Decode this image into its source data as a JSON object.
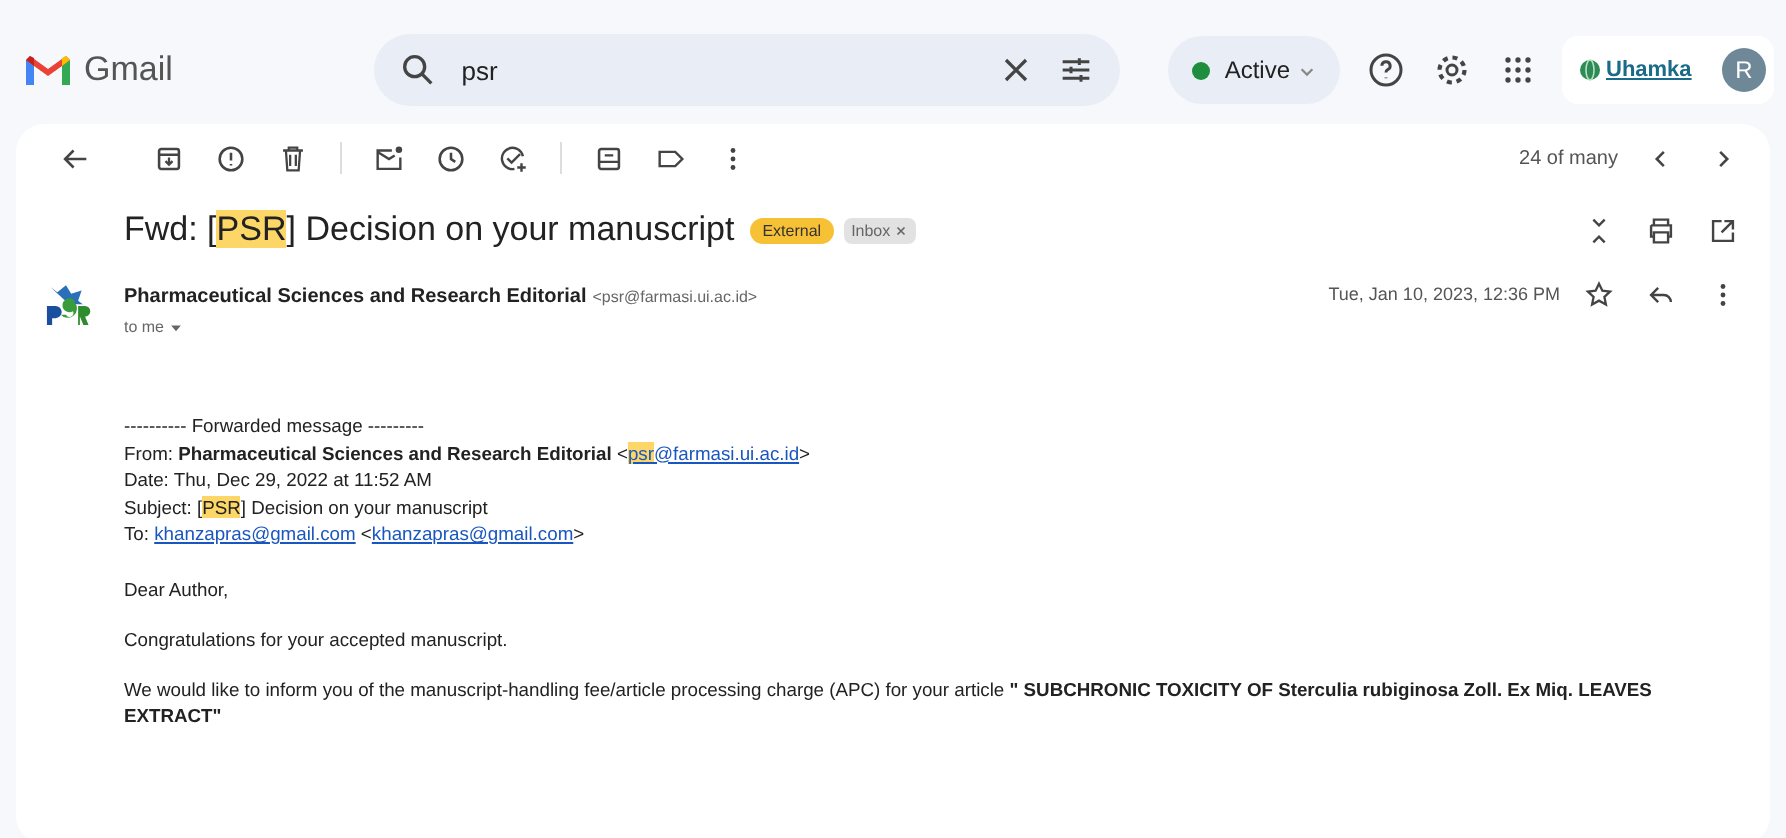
{
  "app": {
    "name": "Gmail"
  },
  "search": {
    "value": "psr"
  },
  "status": {
    "label": "Active",
    "online": true
  },
  "account": {
    "org_logo": "Uhamka",
    "avatar_letter": "R"
  },
  "toolbar": {
    "counter": "24 of many"
  },
  "message": {
    "subject_parts": [
      {
        "text": "Fwd: [",
        "highlighted": false
      },
      {
        "text": "PSR",
        "highlighted": true
      },
      {
        "text": "] Decision on your manuscript",
        "highlighted": false
      }
    ],
    "labels": [
      {
        "text": "External",
        "kind": "external"
      },
      {
        "text": "Inbox",
        "kind": "removable"
      }
    ],
    "sender_name": "Pharmaceutical Sciences and Research Editorial",
    "sender_email": "<psr@farmasi.ui.ac.id>",
    "recipient": "to me",
    "date": "Tue, Jan 10, 2023, 12:36 PM",
    "forward_header": [
      [
        {
          "kind": "text",
          "parts": [
            {
              "text": "---------- Forwarded message ---------",
              "highlighted": false
            }
          ]
        }
      ],
      [
        {
          "kind": "text",
          "parts": [
            {
              "text": "From: ",
              "highlighted": false
            }
          ]
        },
        {
          "kind": "bold",
          "parts": [
            {
              "text": "Pharmaceutical Sciences and Research Editorial",
              "highlighted": false
            }
          ]
        },
        {
          "kind": "text",
          "parts": [
            {
              "text": " <",
              "highlighted": false
            }
          ]
        },
        {
          "kind": "link",
          "parts": [
            {
              "text": "psr",
              "highlighted": true
            },
            {
              "text": "@farmasi.ui.ac.id",
              "highlighted": false
            }
          ]
        },
        {
          "kind": "text",
          "parts": [
            {
              "text": ">",
              "highlighted": false
            }
          ]
        }
      ],
      [
        {
          "kind": "text",
          "parts": [
            {
              "text": "Date: Thu, Dec 29, 2022 at 11:52 AM",
              "highlighted": false
            }
          ]
        }
      ],
      [
        {
          "kind": "text",
          "parts": [
            {
              "text": "Subject: [",
              "highlighted": false
            },
            {
              "text": "PSR",
              "highlighted": true
            },
            {
              "text": "] Decision on your manuscript",
              "highlighted": false
            }
          ]
        }
      ],
      [
        {
          "kind": "text",
          "parts": [
            {
              "text": "To: ",
              "highlighted": false
            }
          ]
        },
        {
          "kind": "link",
          "parts": [
            {
              "text": "khanzapras@gmail.com",
              "highlighted": false
            }
          ]
        },
        {
          "kind": "text",
          "parts": [
            {
              "text": " <",
              "highlighted": false
            }
          ]
        },
        {
          "kind": "link",
          "parts": [
            {
              "text": "khanzapras@gmail.com",
              "highlighted": false
            }
          ]
        },
        {
          "kind": "text",
          "parts": [
            {
              "text": ">",
              "highlighted": false
            }
          ]
        }
      ]
    ],
    "paragraphs": [
      "Dear Author,",
      "Congratulations for your accepted manuscript.",
      "We would like to inform you of the manuscript-handling fee/article processing charge (APC) for your article **\"  SUBCHRONIC TOXICITY OF Sterculia rubiginosa Zoll. Ex Miq. LEAVES EXTRACT\"**"
    ]
  }
}
